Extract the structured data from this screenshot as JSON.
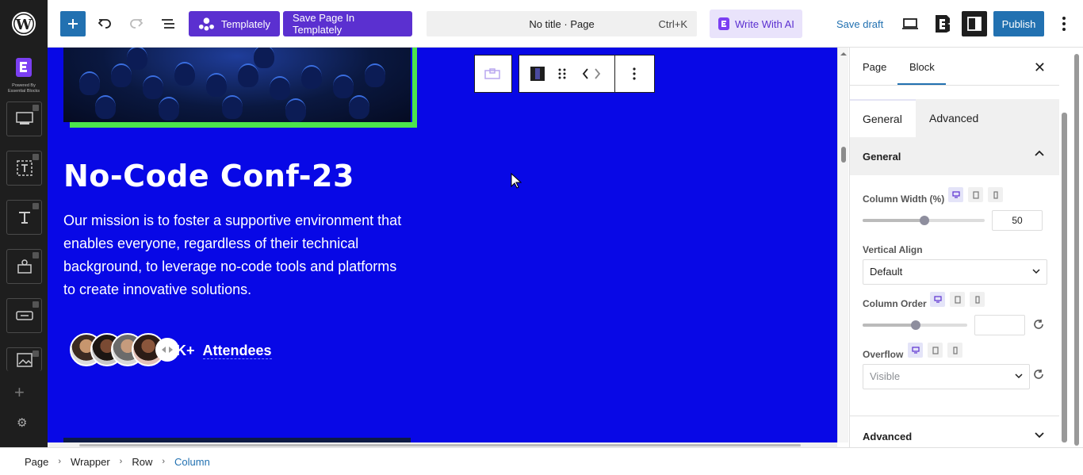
{
  "toolbar": {
    "templately_label": "Templately",
    "save_templately_label": "Save Page In Templately",
    "document_title": "No title · Page",
    "shortcut": "Ctrl+K",
    "write_ai_label": "Write With AI",
    "save_draft_label": "Save draft",
    "publish_label": "Publish"
  },
  "rail": {
    "badge_caption": "Powered By Essential Blocks"
  },
  "canvas": {
    "title": "No-Code Conf-23",
    "description": "Our mission is to foster a supportive environment that enables everyone, regardless of their technical background, to leverage no-code tools and platforms to create innovative solutions.",
    "attendees_count": "K+",
    "attendees_label": "Attendees",
    "background": "#0808e6",
    "frame_color": "#4ce44c"
  },
  "sidebar": {
    "tabs": [
      {
        "label": "Page"
      },
      {
        "label": "Block"
      }
    ],
    "sub_tabs": [
      {
        "label": "General"
      },
      {
        "label": "Advanced"
      }
    ],
    "panel_title": "General",
    "column_width_label": "Column Width (%)",
    "column_width_value": "50",
    "vertical_align_label": "Vertical Align",
    "vertical_align_value": "Default",
    "column_order_label": "Column Order",
    "column_order_value": "",
    "overflow_label": "Overflow",
    "overflow_value": "Visible",
    "advanced_panel_title": "Advanced"
  },
  "breadcrumb": [
    {
      "label": "Page"
    },
    {
      "label": "Wrapper"
    },
    {
      "label": "Row"
    },
    {
      "label": "Column"
    }
  ],
  "colors": {
    "accent": "#2271b1",
    "brand_purple": "#5b30d0"
  }
}
